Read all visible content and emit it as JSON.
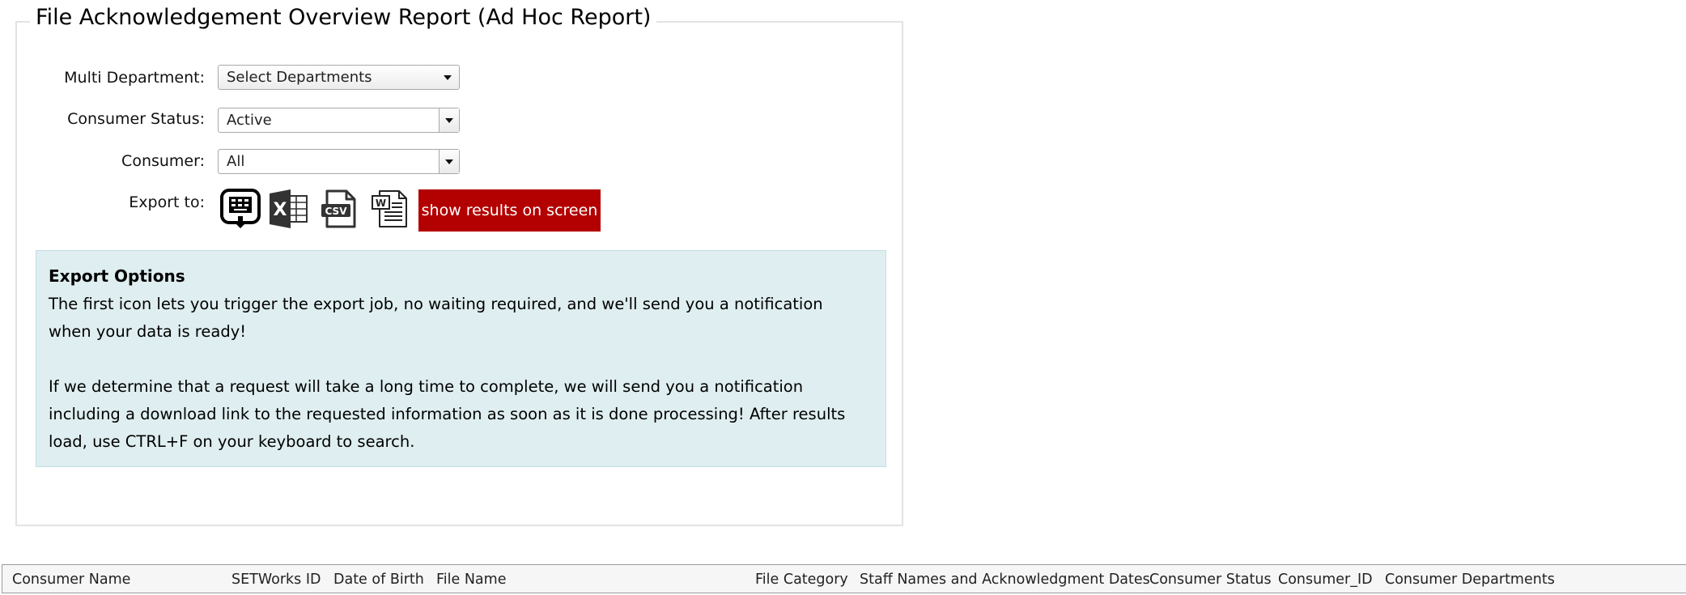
{
  "report": {
    "title": "File Acknowledgement Overview Report (Ad Hoc Report)"
  },
  "filters": {
    "multi_department": {
      "label": "Multi Department:",
      "value": "Select Departments"
    },
    "consumer_status": {
      "label": "Consumer Status:",
      "value": "Active"
    },
    "consumer": {
      "label": "Consumer:",
      "value": "All"
    }
  },
  "export": {
    "label": "Export to:",
    "icons": [
      "background-export-icon",
      "excel-icon",
      "csv-icon",
      "word-icon"
    ],
    "show_results_label": "show results on screen",
    "button_color": "#b30000"
  },
  "export_options": {
    "heading": "Export Options",
    "paragraph_1": "The first icon lets you trigger the export job, no waiting required, and we'll send you a notification when your data is ready!",
    "paragraph_2": "If we determine that a request will take a long time to complete, we will send you a notification including a download link to the requested information as soon as it is done processing! After results load, use CTRL+F on your keyboard to search.",
    "panel_color": "#dfeef0"
  },
  "results_table": {
    "columns": [
      "Consumer Name",
      "SETWorks ID",
      "Date of Birth",
      "File Name",
      "File Category",
      "Staff Names and Acknowledgment Dates",
      "Consumer Status",
      "Consumer_ID",
      "Consumer Departments"
    ]
  }
}
